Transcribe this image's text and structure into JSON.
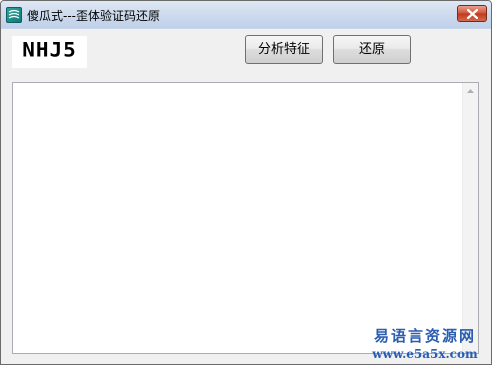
{
  "window": {
    "title": "傻瓜式---歪体验证码还原"
  },
  "titlebar": {
    "app_icon": "app-logo-icon",
    "close_icon": "close-icon"
  },
  "captcha": {
    "text": "NHJ5"
  },
  "toolbar": {
    "analyze_label": "分析特征",
    "restore_label": "还原"
  },
  "output": {
    "value": ""
  },
  "scrollbar": {
    "up_icon": "arrow-up-icon"
  },
  "watermark": {
    "site_name": "易语言资源网",
    "url": "www.e5a5x.com"
  }
}
